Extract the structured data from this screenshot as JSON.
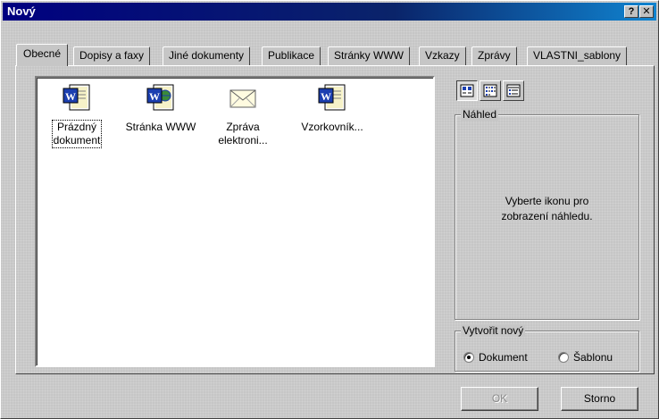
{
  "window": {
    "title": "Nový",
    "help_label": "?",
    "close_label": "✕"
  },
  "tabs": [
    {
      "label": "Obecné",
      "active": true
    },
    {
      "label": "Dopisy a faxy"
    },
    {
      "label": "Jiné dokumenty"
    },
    {
      "label": "Publikace"
    },
    {
      "label": "Stránky WWW"
    },
    {
      "label": "Vzkazy"
    },
    {
      "label": "Zprávy"
    },
    {
      "label": "VLASTNI_sablony"
    }
  ],
  "files": [
    {
      "line1": "Prázdný",
      "line2": "dokument",
      "icon": "word-document-icon",
      "focused": true
    },
    {
      "line1": "Stránka WWW",
      "line2": "",
      "icon": "web-page-icon"
    },
    {
      "line1": "Zpráva",
      "line2": "elektroni...",
      "icon": "envelope-icon"
    },
    {
      "line1": "Vzorkovník...",
      "line2": "",
      "icon": "word-document-icon"
    }
  ],
  "view_buttons": [
    {
      "name": "large-icons-view",
      "icon": "large-icons-icon",
      "pressed": true
    },
    {
      "name": "list-view",
      "icon": "list-icon"
    },
    {
      "name": "details-view",
      "icon": "details-icon"
    }
  ],
  "preview": {
    "legend": "Náhled",
    "line1": "Vyberte ikonu pro",
    "line2": "zobrazení náhledu."
  },
  "create_new": {
    "legend": "Vytvořit nový",
    "options": [
      {
        "label": "Dokument",
        "selected": true
      },
      {
        "label": "Šablonu",
        "selected": false
      }
    ]
  },
  "buttons": {
    "ok_label": "OK",
    "cancel_label": "Storno"
  },
  "colors": {
    "titlebar": "#000080",
    "face": "#c6c6c6",
    "word_blue": "#1c3fb0"
  }
}
